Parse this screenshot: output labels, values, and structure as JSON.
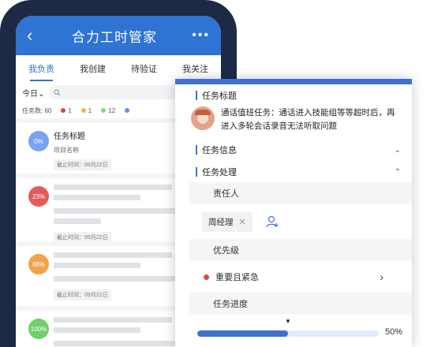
{
  "app": {
    "title": "合力工时管家"
  },
  "tabs": [
    {
      "label": "我负责",
      "active": true
    },
    {
      "label": "我创建",
      "active": false
    },
    {
      "label": "待验证",
      "active": false
    },
    {
      "label": "我关注",
      "active": false
    }
  ],
  "filter": {
    "today_label": "今日",
    "today_arrow": "⌄"
  },
  "stats": {
    "total_label": "任务数: 60",
    "items": [
      {
        "value": "1",
        "color": "#d94848"
      },
      {
        "value": "1",
        "color": "#f0b43a"
      },
      {
        "value": "12",
        "color": "#8bd080"
      }
    ],
    "extra_color": "#6a8ee6"
  },
  "tasks": [
    {
      "progress": "0%",
      "color": "#7aa3f0",
      "title": "任务标题",
      "subtitle": "项目名称",
      "date": "截止时间：09月22日"
    },
    {
      "progress": "23%",
      "color": "#e25b5b",
      "date": "截止时间：09月22日"
    },
    {
      "progress": "88%",
      "color": "#f2a24a",
      "date": "截止时间：09月22日"
    },
    {
      "progress": "100%",
      "color": "#6fcf6a"
    }
  ],
  "card": {
    "task_title_section": "任务标题",
    "message": "通话值班任务：通话进入技能组等等超时后，再进入多轮会话录音无法听取问题",
    "task_info_section": "任务信息",
    "task_process_section": "任务处理",
    "assignee_label": "责任人",
    "assignee_name": "周经理",
    "priority_label": "优先级",
    "priority_value": "重要且紧急",
    "priority_color": "#d94848",
    "progress_label": "任务进度",
    "progress_value": "50%",
    "progress_fraction": 0.5
  },
  "colors": {
    "brand": "#2f73d3",
    "phone_frame": "#1e2a45"
  }
}
